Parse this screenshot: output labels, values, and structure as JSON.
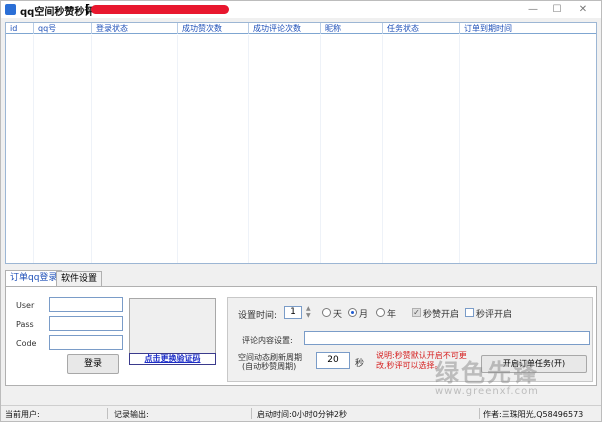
{
  "window": {
    "title": "qq空间秒赞秒评",
    "title_bracket": "[",
    "minimize_symbol": "—",
    "maximize_symbol": "☐",
    "close_symbol": "✕"
  },
  "table": {
    "columns": [
      "id",
      "qq号",
      "登录状态",
      "成功赞次数",
      "成功评论次数",
      "昵称",
      "任务状态",
      "订单到期时间"
    ]
  },
  "tabs": [
    {
      "label": "订单qq登录",
      "active": true
    },
    {
      "label": "软件设置",
      "active": false
    }
  ],
  "login": {
    "user_label": "User",
    "pass_label": "Pass",
    "code_label": "Code",
    "user_value": "",
    "pass_value": "",
    "code_value": "",
    "login_button": "登录",
    "refresh_captcha": "点击更换验证码"
  },
  "settings": {
    "time_label": "设置时间:",
    "time_value": "1",
    "radio_day": "天",
    "radio_month": "月",
    "radio_year": "年",
    "selected_unit": "月",
    "like_label": "秒赞开启",
    "comment_label": "秒评开启",
    "comment_content_label": "评论内容设置:",
    "comment_content_value": "",
    "cycle_label_1": "空间动态刷新周期",
    "cycle_label_2": "(自动秒赞周期)",
    "cycle_value": "20",
    "cycle_unit": "秒",
    "note": "说明:秒赞默认开启不可更改,秒评可以选择。",
    "start_button": "开启订单任务(开)"
  },
  "status_bar": {
    "current_user": "当前用户:",
    "log_output": "记录输出:",
    "uptime": "启动时间:0小时0分钟2秒",
    "author": "作者:三珠阳光,Q58496573"
  },
  "watermark": {
    "text": "绿色先锋",
    "url": "www.greenxf.com"
  },
  "colors": {
    "accent": "#1d4fb8",
    "redaction": "#e8172e",
    "note": "#d62020"
  }
}
